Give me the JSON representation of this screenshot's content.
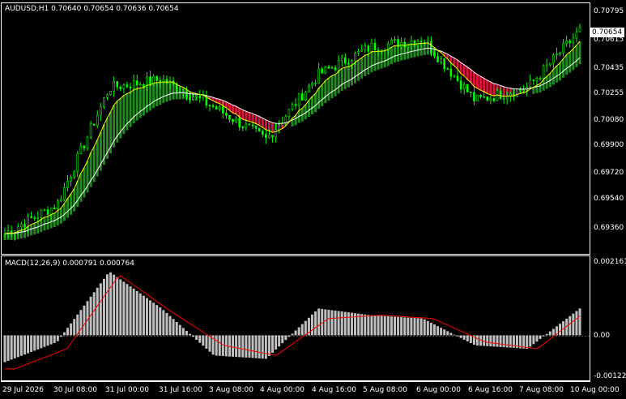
{
  "main_panel": {
    "title": "AUDUSD,H1  0.70640 0.70654 0.70636 0.70654",
    "current_price": "0.70654",
    "price_labels": [
      "0.70795",
      "0.70615",
      "0.70435",
      "0.70255",
      "0.70080",
      "0.69900",
      "0.69720",
      "0.69540",
      "0.69360"
    ],
    "colors": {
      "bull_candle": "#00ff00",
      "bear_candle": "#00ff00",
      "ma_fast": "#ffff00",
      "ma_slow": "#ffffff",
      "cloud_up": "#228b22",
      "cloud_down": "#dc143c"
    }
  },
  "macd_panel": {
    "title": "MACD(12,26,9) 0.000791 0.000764",
    "price_labels": [
      "0.002161",
      "0.00",
      "-0.00122"
    ],
    "colors": {
      "histogram": "#c0c0c0",
      "signal": "#ff0000"
    }
  },
  "time_labels": [
    "29 Jul 2026",
    "30 Jul 08:00",
    "31 Jul 00:00",
    "31 Jul 16:00",
    "3 Aug 08:00",
    "4 Aug 00:00",
    "4 Aug 16:00",
    "5 Aug 08:00",
    "6 Aug 00:00",
    "6 Aug 16:00",
    "7 Aug 08:00",
    "10 Aug 00:00"
  ],
  "chart_data": {
    "type": "line",
    "price": {
      "x": [
        "29 Jul 2026",
        "30 Jul 08:00",
        "31 Jul 00:00",
        "31 Jul 16:00",
        "3 Aug 08:00",
        "4 Aug 00:00",
        "4 Aug 16:00",
        "5 Aug 08:00",
        "6 Aug 00:00",
        "6 Aug 16:00",
        "7 Aug 08:00",
        "10 Aug 00:00"
      ],
      "close": [
        0.694,
        0.6958,
        0.703,
        0.7035,
        0.7018,
        0.6998,
        0.7038,
        0.7055,
        0.706,
        0.7022,
        0.703,
        0.7065
      ],
      "ylim": [
        0.6928,
        0.7082
      ]
    },
    "macd": {
      "histogram": [
        -0.0008,
        -0.0002,
        0.0019,
        0.0008,
        -0.0006,
        -0.0007,
        0.0008,
        0.0006,
        0.0005,
        -0.0003,
        -0.0004,
        0.0008
      ],
      "signal": [
        -0.001,
        -0.0004,
        0.0018,
        0.0007,
        -0.0003,
        -0.0006,
        0.0005,
        0.0006,
        0.0005,
        -0.0002,
        -0.0004,
        0.0008
      ],
      "ylim": [
        -0.00122,
        0.002161
      ]
    }
  }
}
